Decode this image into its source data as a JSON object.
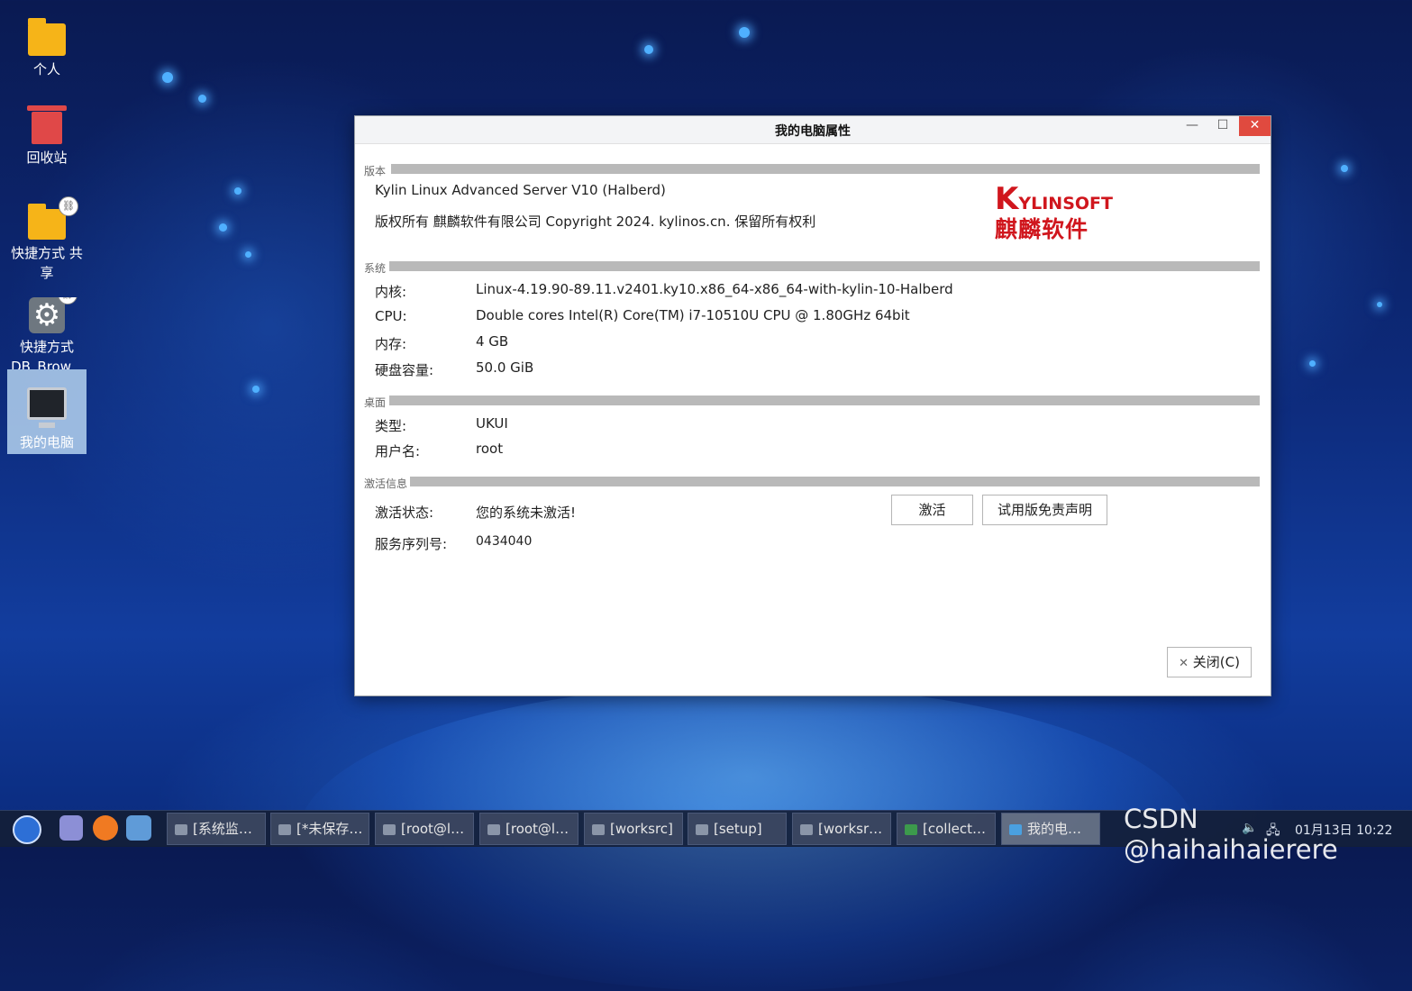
{
  "desktop": {
    "icons": [
      {
        "label": "个人"
      },
      {
        "label": "回收站"
      },
      {
        "label": "快捷方式 共享"
      },
      {
        "label": "快捷方式 DB_Brow..."
      },
      {
        "label": "我的电脑"
      }
    ]
  },
  "window": {
    "title": "我的电脑属性",
    "controls": {
      "minimize": "—",
      "maximize": "☐",
      "close": "✕"
    },
    "sections": {
      "version": {
        "label": "版本",
        "product": "Kylin Linux Advanced Server V10 (Halberd)",
        "copyright": "版权所有 麒麟软件有限公司 Copyright 2024. kylinos.cn.  保留所有权利"
      },
      "system": {
        "label": "系统",
        "rows": [
          {
            "key": "内核:",
            "value": "Linux-4.19.90-89.11.v2401.ky10.x86_64-x86_64-with-kylin-10-Halberd"
          },
          {
            "key": "CPU:",
            "value": "Double cores Intel(R) Core(TM) i7-10510U CPU @ 1.80GHz 64bit"
          },
          {
            "key": "内存:",
            "value": "4 GB"
          },
          {
            "key": "硬盘容量:",
            "value": "50.0 GiB"
          }
        ]
      },
      "desktop": {
        "label": "桌面",
        "rows": [
          {
            "key": "类型:",
            "value": "UKUI"
          },
          {
            "key": "用户名:",
            "value": "root"
          }
        ]
      },
      "activation": {
        "label": "激活信息",
        "status_key": "激活状态:",
        "status_value": "您的系统未激活!",
        "serial_key": "服务序列号:",
        "serial_value": "0434040",
        "activate_button": "激活",
        "trial_button": "试用版免责声明"
      }
    },
    "logo": {
      "en_first": "K",
      "en_rest": "YLINSOFT",
      "cn": "麒麟软件"
    },
    "close_button": "关闭(C)",
    "close_button_icon": "✕"
  },
  "taskbar": {
    "tasks": [
      {
        "label": "[系统监…"
      },
      {
        "label": "[*未保存…"
      },
      {
        "label": "[root@l…"
      },
      {
        "label": "[root@l…"
      },
      {
        "label": "[worksrc]"
      },
      {
        "label": "[setup]"
      },
      {
        "label": "[worksr…"
      },
      {
        "label": "[collect…"
      },
      {
        "label": "我的电…"
      }
    ],
    "clock": "01月13日 10:22"
  },
  "watermark": "CSDN @haihaihaierere",
  "colors": {
    "accent_red": "#d0161d",
    "close_red": "#e04a3f",
    "section_bar": "#b9b9b9"
  }
}
